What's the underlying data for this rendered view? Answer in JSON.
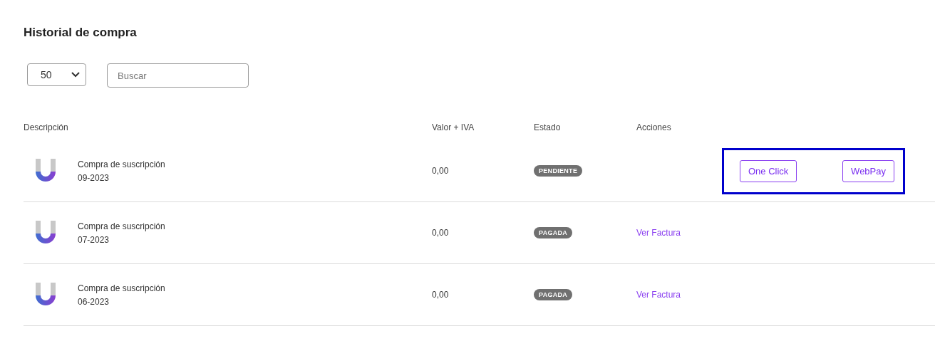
{
  "title": "Historial de compra",
  "page_size": {
    "value": "50"
  },
  "search": {
    "placeholder": "Buscar"
  },
  "table": {
    "columns": [
      "Descripción",
      "Valor + IVA",
      "Estado",
      "Acciones"
    ],
    "rows": [
      {
        "description": "Compra de suscripción",
        "period": "09-2023",
        "value": "0,00",
        "status": "PENDIENTE",
        "actions": {
          "kind": "buttons",
          "highlighted": true,
          "buttons": [
            "One Click",
            "WebPay"
          ]
        }
      },
      {
        "description": "Compra de suscripción",
        "period": "07-2023",
        "value": "0,00",
        "status": "PAGADA",
        "actions": {
          "kind": "link",
          "label": "Ver Factura"
        }
      },
      {
        "description": "Compra de suscripción",
        "period": "06-2023",
        "value": "0,00",
        "status": "PAGADA",
        "actions": {
          "kind": "link",
          "label": "Ver Factura"
        }
      }
    ]
  }
}
